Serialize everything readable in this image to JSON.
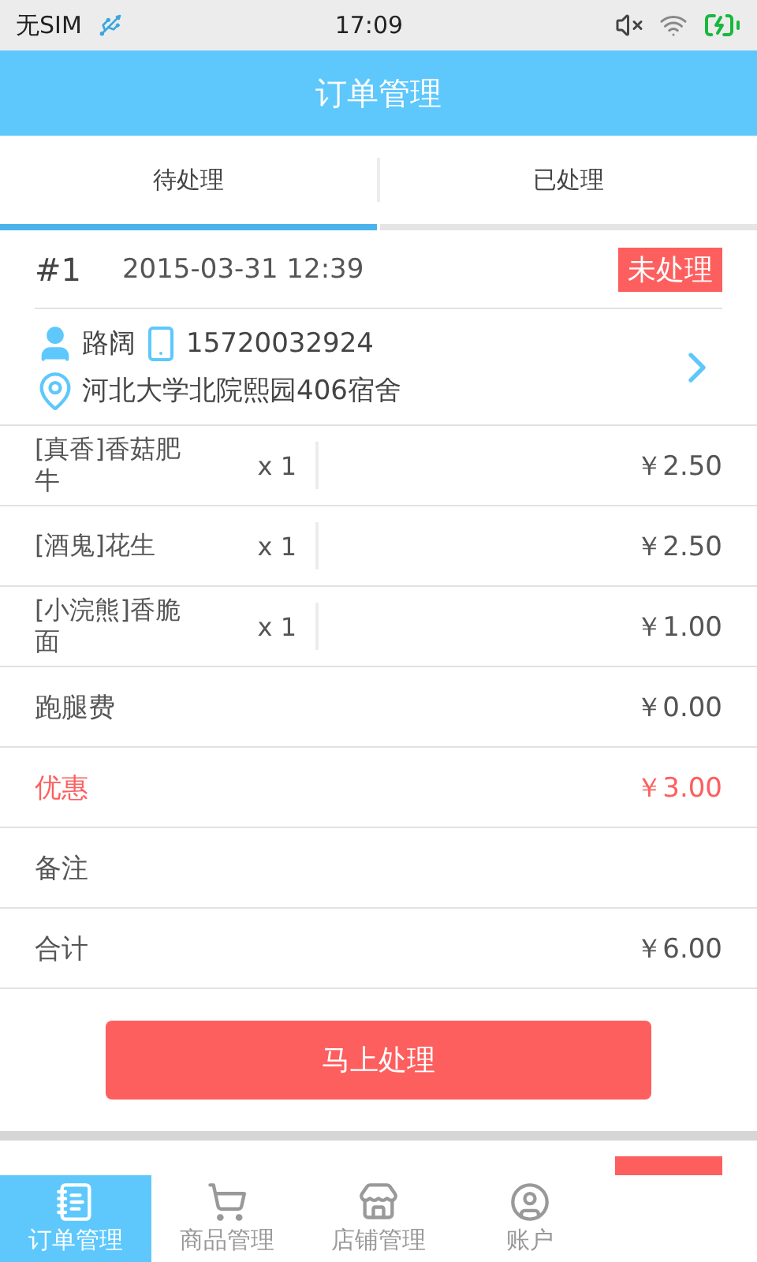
{
  "status_bar": {
    "carrier": "无SIM",
    "time": "17:09"
  },
  "header": {
    "title": "订单管理"
  },
  "tabs": [
    {
      "label": "待处理",
      "selected": true
    },
    {
      "label": "已处理",
      "selected": false
    }
  ],
  "orders": [
    {
      "number": "#1",
      "time": "2015-03-31 12:39",
      "status": "未处理",
      "customer": "路阔",
      "phone": "15720032924",
      "address": "河北大学北院熙园406宿舍",
      "items": [
        {
          "name": "[真香]香菇肥牛",
          "qty": "x 1",
          "price": "￥2.50"
        },
        {
          "name": "[酒鬼]花生",
          "qty": "x 1",
          "price": "￥2.50"
        },
        {
          "name": "[小浣熊]香脆面",
          "qty": "x 1",
          "price": "￥1.00"
        }
      ],
      "summary": [
        {
          "label": "跑腿费",
          "value": "￥0.00",
          "highlight": false
        },
        {
          "label": "优惠",
          "value": "￥3.00",
          "highlight": true
        },
        {
          "label": "备注",
          "highlight": false
        },
        {
          "label": "合计",
          "value": "￥6.00",
          "highlight": false
        }
      ],
      "action": "马上处理"
    }
  ],
  "bottom_tabs": [
    {
      "label": "订单管理",
      "kind": "orders",
      "selected": true
    },
    {
      "label": "商品管理",
      "kind": "cart",
      "selected": false
    },
    {
      "label": "店铺管理",
      "kind": "store",
      "selected": false
    },
    {
      "label": "账户",
      "kind": "account",
      "selected": false
    }
  ]
}
